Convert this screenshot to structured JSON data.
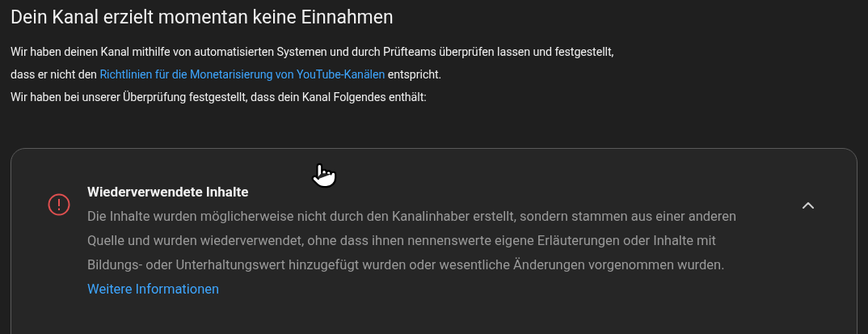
{
  "title": "Dein Kanal erzielt momentan keine Einnahmen",
  "intro": [
    {
      "text": "Wir haben deinen Kanal mithilfe von automatisierten Systemen und durch Prüfteams überprüfen lassen und festgestellt,"
    },
    {
      "text": "dass er nicht den",
      "link": "Richtlinien für die Monetarisierung von YouTube-Kanälen",
      "after": "entspricht."
    },
    {
      "text": "Wir haben bei unserer Überprüfung festgestellt, dass dein Kanal Folgendes enthält:"
    }
  ],
  "issue": {
    "title": "Wiederverwendete Inhalte",
    "expanded": true,
    "description": "Die Inhalte wurden möglicherweise nicht durch den Kanalinhaber erstellt, sondern stammen aus einer anderen Quelle und wurden wiederverwendet, ohne dass ihnen nennenswerte eigene Erläuterungen oder Inhalte mit Bildungs- oder Unterhaltungswert hinzugefügt wurden oder wesentliche Änderungen vorgenommen wurden.",
    "link": "Weitere Informationen"
  }
}
